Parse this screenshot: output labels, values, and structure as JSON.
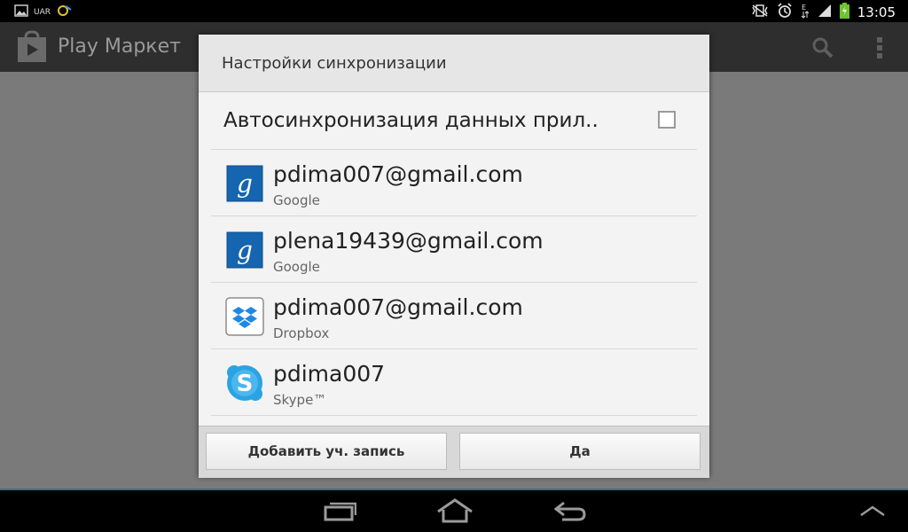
{
  "status_bar": {
    "operator_label": "UAR",
    "time": "13:05",
    "network_type": "E",
    "icons": [
      "picture-icon",
      "tv-icon",
      "muted-vibrate-icon",
      "alarm-icon",
      "signal-icon",
      "battery-icon"
    ]
  },
  "action_bar": {
    "title": "Play Маркет"
  },
  "dialog": {
    "title": "Настройки синхронизации",
    "auto_sync_label": "Автосинхронизация данных прил..",
    "auto_sync_checked": false,
    "accounts": [
      {
        "name": "pdima007@gmail.com",
        "type": "Google",
        "icon": "google-icon"
      },
      {
        "name": "plena19439@gmail.com",
        "type": "Google",
        "icon": "google-icon"
      },
      {
        "name": "pdima007@gmail.com",
        "type": "Dropbox",
        "icon": "dropbox-icon"
      },
      {
        "name": "pdima007",
        "type": "Skype™",
        "icon": "skype-icon"
      }
    ],
    "buttons": {
      "add_account": "Добавить уч. запись",
      "ok": "Да"
    }
  },
  "colors": {
    "google_blue": "#1565b0",
    "dropbox_blue": "#1e88e5",
    "skype_blue": "#2aa3e3",
    "accent_line": "#3a6f86"
  }
}
